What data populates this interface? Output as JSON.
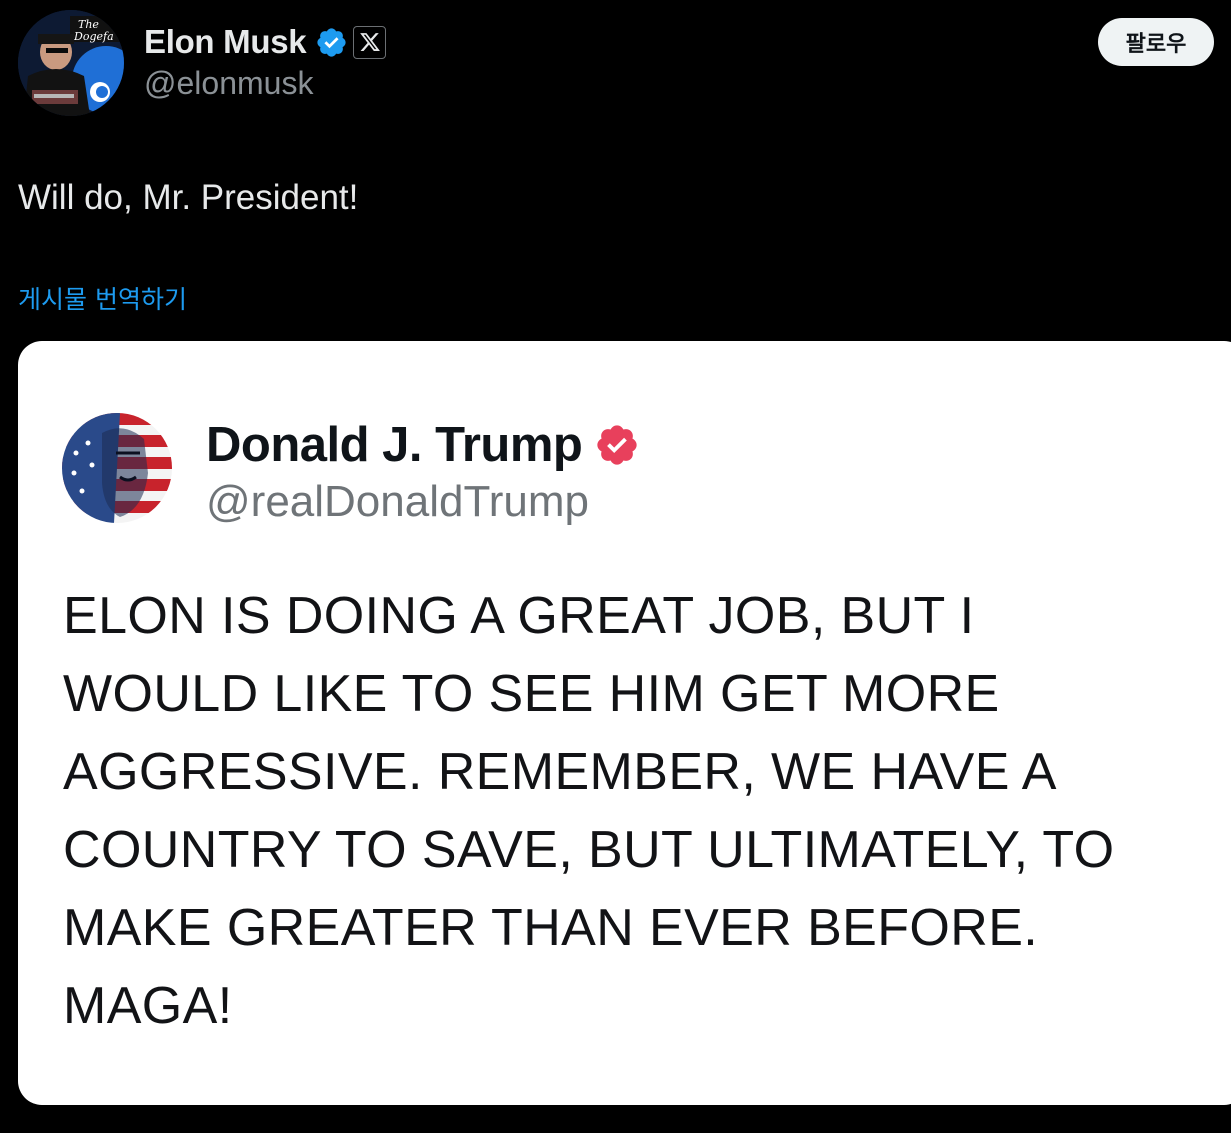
{
  "author": {
    "name": "Elon Musk",
    "handle": "@elonmusk",
    "verified_icon": "verified-badge-icon",
    "affiliate_icon": "x-logo-icon"
  },
  "follow_button": {
    "label": "팔로우"
  },
  "tweet": {
    "text": "Will do, Mr. President!",
    "translate_link": "게시물 번역하기"
  },
  "quote": {
    "name": "Donald J. Trump",
    "handle": "@realDonaldTrump",
    "text": "ELON IS DOING A GREAT JOB, BUT I\nWOULD LIKE TO SEE HIM GET MORE\nAGGRESSIVE. REMEMBER, WE HAVE A\nCOUNTRY TO SAVE, BUT ULTIMATELY, TO\nMAKE GREATER THAN EVER BEFORE.\nMAGA!",
    "verified_icon": "verified-badge-icon"
  },
  "colors": {
    "background": "#000000",
    "link": "#1d9bf0",
    "verified_blue": "#1d9bf0",
    "verified_pink": "#e8405c",
    "card": "#ffffff"
  }
}
